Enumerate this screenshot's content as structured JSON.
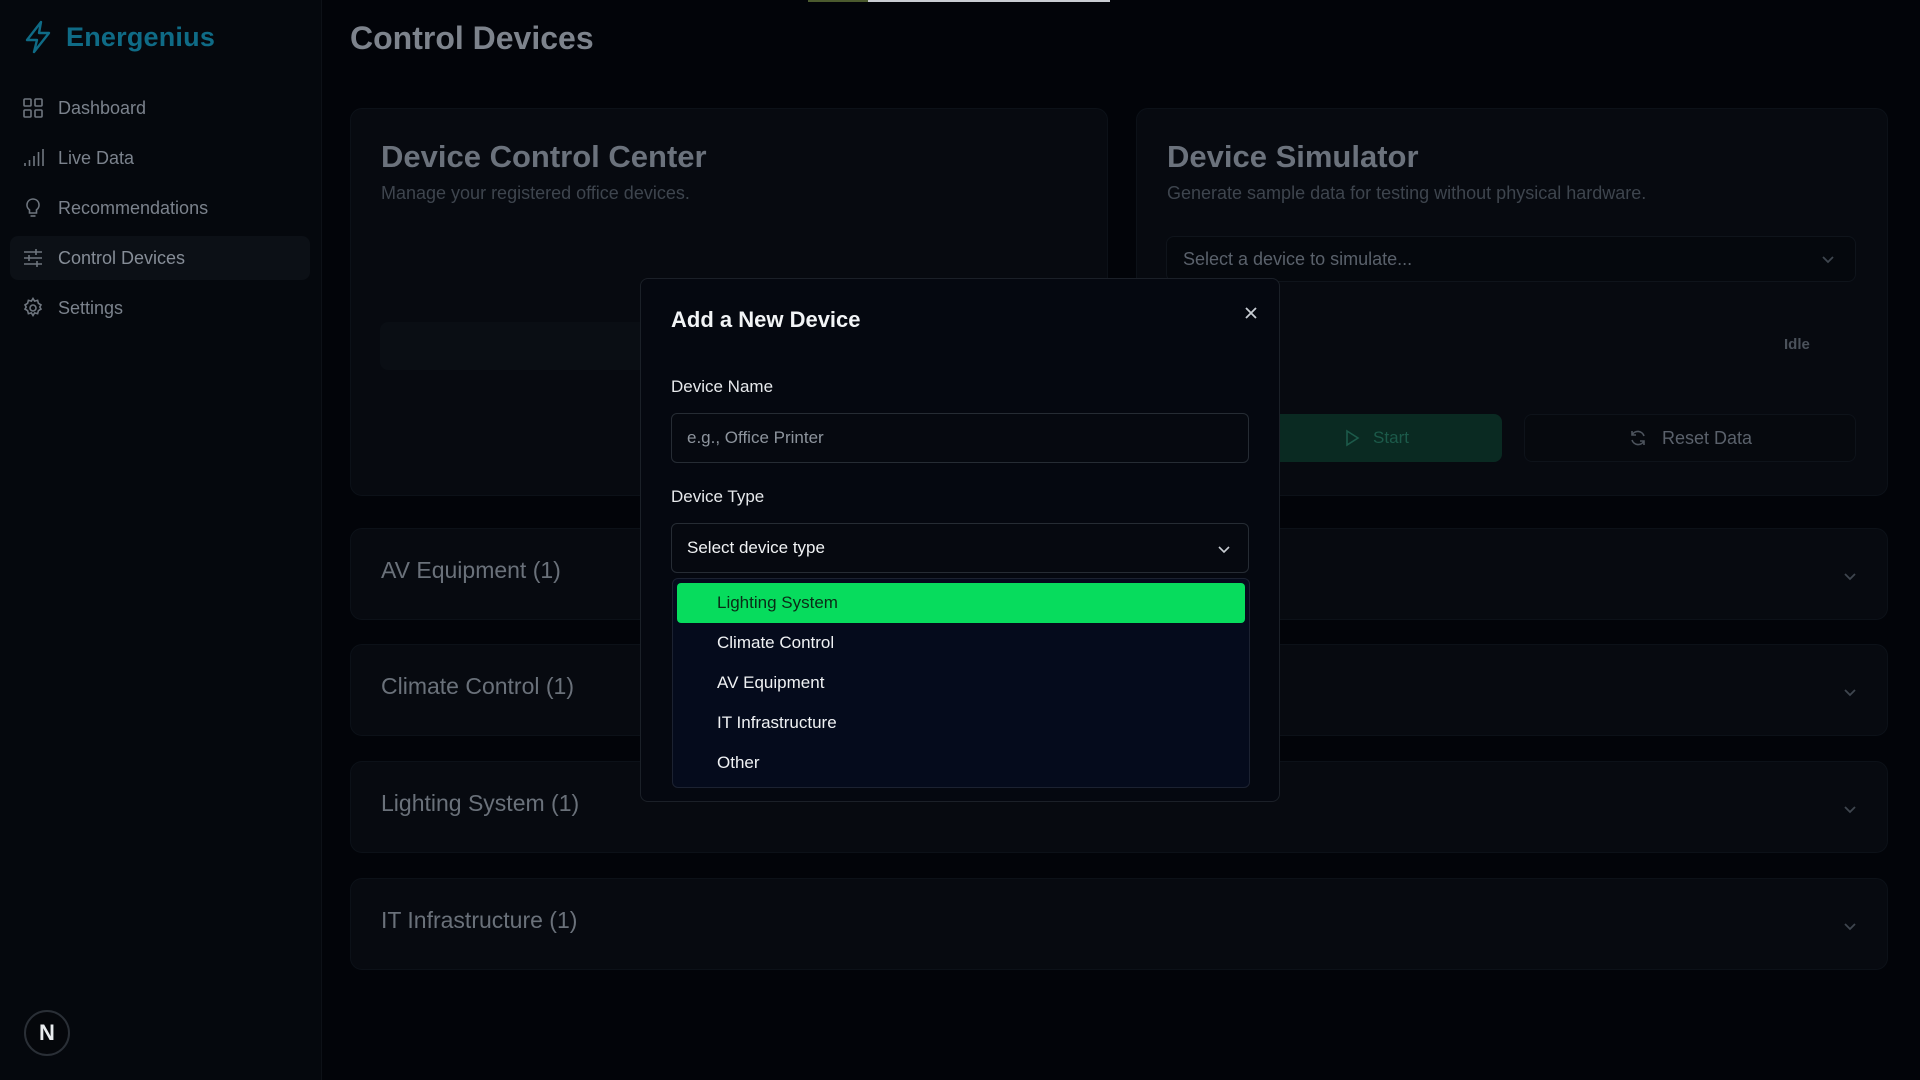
{
  "brand": {
    "name": "Energenius",
    "accent": "#0f6b86"
  },
  "sidebar": {
    "items": [
      {
        "label": "Dashboard",
        "icon": "grid-icon"
      },
      {
        "label": "Live Data",
        "icon": "signal-icon"
      },
      {
        "label": "Recommendations",
        "icon": "lightbulb-icon"
      },
      {
        "label": "Control Devices",
        "icon": "sliders-icon",
        "active": true
      },
      {
        "label": "Settings",
        "icon": "gear-icon"
      }
    ],
    "avatar_initial": "N"
  },
  "page": {
    "title": "Control Devices"
  },
  "control_center": {
    "title": "Device Control Center",
    "subtitle": "Manage your registered office devices."
  },
  "simulator": {
    "title": "Device Simulator",
    "subtitle": "Generate sample data for testing without physical hardware.",
    "select_placeholder": "Select a device to simulate...",
    "status_label": "s",
    "status_badge": "Idle",
    "start_label": "Start",
    "reset_label": "Reset Data"
  },
  "groups": [
    {
      "label": "AV Equipment (1)"
    },
    {
      "label": "Climate Control (1)"
    },
    {
      "label": "Lighting System (1)"
    },
    {
      "label": "IT Infrastructure (1)"
    }
  ],
  "modal": {
    "title": "Add a New Device",
    "device_name_label": "Device Name",
    "device_name_placeholder": "e.g., Office Printer",
    "device_type_label": "Device Type",
    "device_type_value": "Select device type",
    "options": [
      {
        "label": "Lighting System",
        "highlighted": true
      },
      {
        "label": "Climate Control"
      },
      {
        "label": "AV Equipment"
      },
      {
        "label": "IT Infrastructure"
      },
      {
        "label": "Other"
      }
    ],
    "highlight_color": "#07dc5d"
  }
}
